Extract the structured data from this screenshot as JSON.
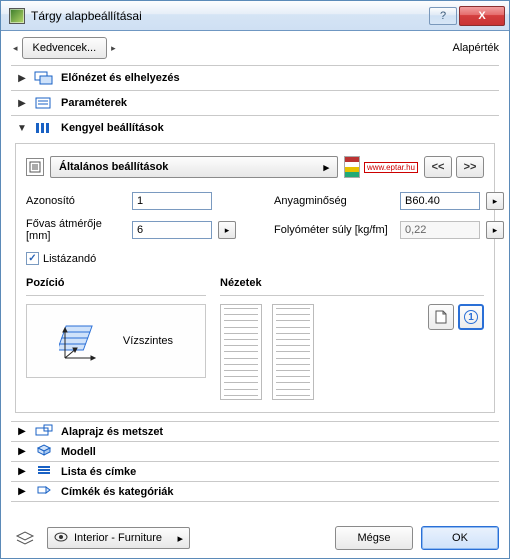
{
  "window": {
    "title": "Tárgy alapbeállításai",
    "help_glyph": "?",
    "close_glyph": "X"
  },
  "toprow": {
    "favorites_label": "Kedvencek...",
    "defaults_label": "Alapérték"
  },
  "panels": {
    "preview": "Előnézet és elhelyezés",
    "params": "Paraméterek",
    "settings": "Kengyel beállítások",
    "floorplan": "Alaprajz és metszet",
    "model": "Modell",
    "list": "Lista és címke",
    "tags": "Címkék és kategóriák"
  },
  "settings": {
    "general_label": "Általános beállítások",
    "eptar_text": "www.eptar.hu",
    "prev_glyph": "<<",
    "next_glyph": ">>",
    "id_label": "Azonosító",
    "id_value": "1",
    "quality_label": "Anyagminőség",
    "quality_value": "B60.40",
    "diam_label": "Fővas átmérője [mm]",
    "diam_value": "6",
    "weight_label": "Folyóméter súly [kg/fm]",
    "weight_value": "0,22",
    "listable_label": "Listázandó",
    "listable_checked": true
  },
  "position": {
    "title": "Pozíció",
    "mode": "Vízszintes"
  },
  "views": {
    "title": "Nézetek",
    "badge": "1"
  },
  "footer": {
    "layer_label": "Interior - Furniture",
    "cancel": "Mégse",
    "ok": "OK"
  },
  "glyphs": {
    "tri_right": "▶",
    "tri_down": "▼",
    "dd_arrow": "▸"
  }
}
